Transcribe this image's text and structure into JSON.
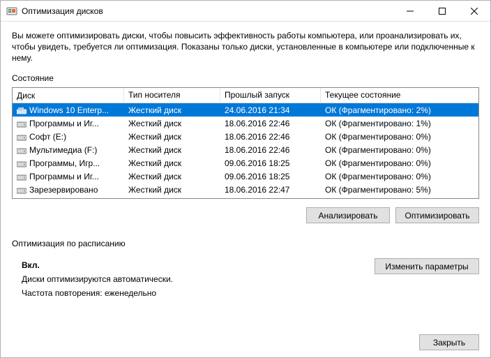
{
  "titlebar": {
    "title": "Оптимизация дисков"
  },
  "intro": "Вы можете оптимизировать диски, чтобы повысить эффективность работы компьютера, или проанализировать их, чтобы увидеть, требуется ли оптимизация. Показаны только диски, установленные в компьютере или подключенные к нему.",
  "section_state": "Состояние",
  "columns": {
    "disk": "Диск",
    "media": "Тип носителя",
    "lastrun": "Прошлый запуск",
    "status": "Текущее состояние"
  },
  "rows": [
    {
      "name": "Windows 10 Enterp...",
      "media": "Жесткий диск",
      "lastrun": "24.06.2016 21:34",
      "status": "ОК (Фрагментировано: 2%)",
      "selected": true,
      "sys": true
    },
    {
      "name": "Программы и Иг...",
      "media": "Жесткий диск",
      "lastrun": "18.06.2016 22:46",
      "status": "ОК (Фрагментировано: 1%)",
      "selected": false,
      "sys": false
    },
    {
      "name": "Софт (E:)",
      "media": "Жесткий диск",
      "lastrun": "18.06.2016 22:46",
      "status": "ОК (Фрагментировано: 0%)",
      "selected": false,
      "sys": false
    },
    {
      "name": "Мультимедиа (F:)",
      "media": "Жесткий диск",
      "lastrun": "18.06.2016 22:46",
      "status": "ОК (Фрагментировано: 0%)",
      "selected": false,
      "sys": false
    },
    {
      "name": "Программы, Игр...",
      "media": "Жесткий диск",
      "lastrun": "09.06.2016 18:25",
      "status": "ОК (Фрагментировано: 0%)",
      "selected": false,
      "sys": false
    },
    {
      "name": "Программы и Иг...",
      "media": "Жесткий диск",
      "lastrun": "09.06.2016 18:25",
      "status": "ОК (Фрагментировано: 0%)",
      "selected": false,
      "sys": false
    },
    {
      "name": "Зарезервировано",
      "media": "Жесткий диск",
      "lastrun": "18.06.2016 22:47",
      "status": "ОК (Фрагментировано: 5%)",
      "selected": false,
      "sys": false
    }
  ],
  "buttons": {
    "analyze": "Анализировать",
    "optimize": "Оптимизировать",
    "change": "Изменить параметры",
    "close": "Закрыть"
  },
  "schedule": {
    "heading": "Оптимизация по расписанию",
    "on": "Вкл.",
    "line1": "Диски оптимизируются автоматически.",
    "freq_label": "Частота повторения: ",
    "freq_value": "еженедельно"
  }
}
